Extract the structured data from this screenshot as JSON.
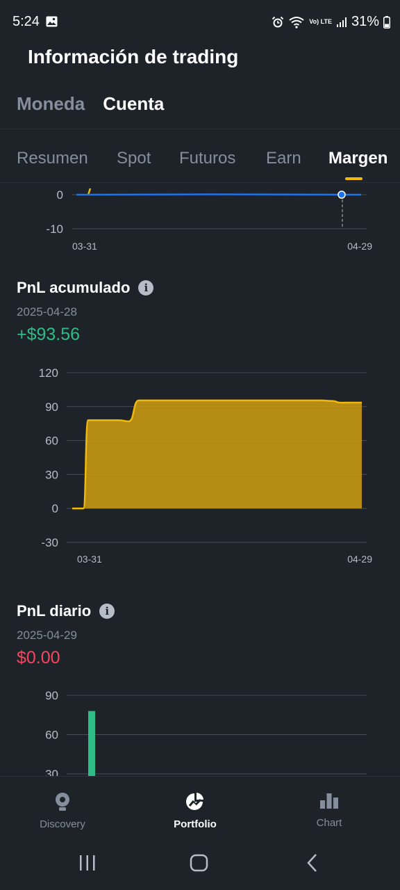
{
  "status_bar": {
    "time": "5:24",
    "battery": "31%",
    "network": "Vo) LTE"
  },
  "title": "Información de trading",
  "top_tabs": [
    {
      "label": "Moneda",
      "active": false
    },
    {
      "label": "Cuenta",
      "active": true
    }
  ],
  "sub_tabs": [
    {
      "label": "Resumen",
      "active": false
    },
    {
      "label": "Spot",
      "active": false
    },
    {
      "label": "Futuros",
      "active": false
    },
    {
      "label": "Earn",
      "active": false
    },
    {
      "label": "Margen",
      "active": true
    }
  ],
  "colors": {
    "accent": "#f0b90b",
    "positive": "#2ebd85",
    "negative": "#f6465d",
    "line": "#1e73e8",
    "background": "#1e2329"
  },
  "top_chart": {
    "y_ticks": [
      "0",
      "-10"
    ],
    "x_start": "03-31",
    "x_end": "04-29"
  },
  "cumulative_pnl": {
    "title": "PnL acumulado",
    "date": "2025-04-28",
    "value": "+$93.56"
  },
  "daily_pnl": {
    "title": "PnL diario",
    "date": "2025-04-29",
    "value": "$0.00"
  },
  "chart_data": [
    {
      "type": "line",
      "x_range": [
        "03-31",
        "04-29"
      ],
      "ylim": [
        -10,
        0
      ],
      "y_ticks": [
        0,
        -10
      ],
      "x": [
        "03-31",
        "04-29"
      ],
      "series": [
        {
          "values": [
            0,
            0
          ]
        }
      ]
    },
    {
      "type": "area",
      "ylim": [
        -30,
        120
      ],
      "y_ticks": [
        120,
        90,
        60,
        30,
        0,
        -30
      ],
      "x_labels": [
        "03-31",
        "04-29"
      ],
      "x": [
        "03-31",
        "04-01",
        "04-02",
        "04-03",
        "04-04",
        "04-05",
        "04-06",
        "04-07",
        "04-08",
        "04-09",
        "04-10",
        "04-11",
        "04-12",
        "04-13",
        "04-14",
        "04-15",
        "04-16",
        "04-17",
        "04-18",
        "04-19",
        "04-20",
        "04-21",
        "04-22",
        "04-23",
        "04-24",
        "04-25",
        "04-26",
        "04-27",
        "04-28"
      ],
      "series": [
        {
          "values": [
            0,
            78,
            78,
            78,
            78,
            77,
            95.5,
            95.5,
            95.5,
            95.5,
            95.5,
            95.5,
            95.5,
            95.5,
            95.5,
            95.5,
            95.5,
            95.5,
            95.5,
            95.5,
            95.5,
            95.5,
            95.5,
            95.5,
            95.5,
            95,
            93.5,
            93.6,
            93.56
          ]
        }
      ]
    },
    {
      "type": "bar",
      "ylim": [
        30,
        90
      ],
      "y_ticks": [
        90,
        60,
        30
      ],
      "x": [
        "04-01"
      ],
      "series": [
        {
          "values": [
            78
          ]
        }
      ]
    }
  ],
  "bottom_nav": [
    {
      "label": "Discovery",
      "icon": "lightbulb-icon",
      "active": false
    },
    {
      "label": "Portfolio",
      "icon": "portfolio-pie-icon",
      "active": true
    },
    {
      "label": "Chart",
      "icon": "bar-chart-icon",
      "active": false
    }
  ]
}
